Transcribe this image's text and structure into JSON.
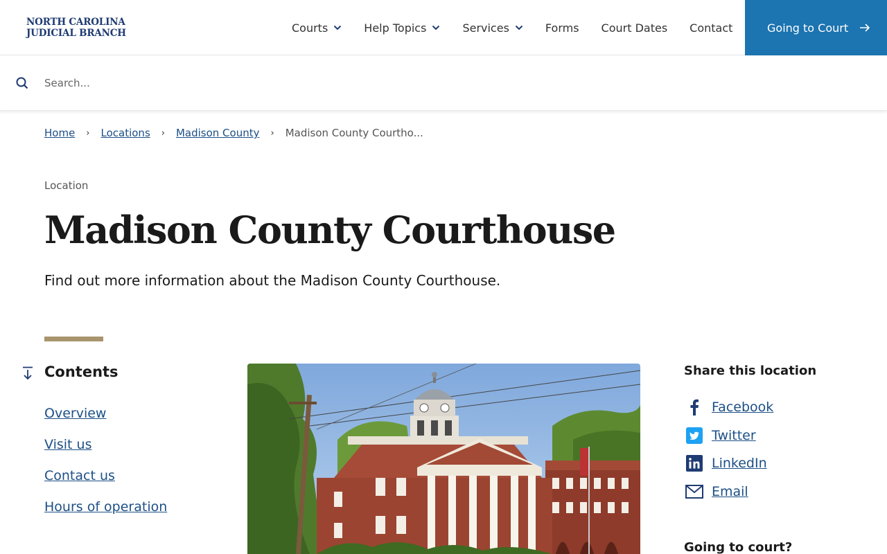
{
  "header": {
    "logo_line1": "NORTH CAROLINA",
    "logo_line2": "JUDICIAL BRANCH",
    "nav": [
      {
        "label": "Courts",
        "has_dropdown": true
      },
      {
        "label": "Help Topics",
        "has_dropdown": true
      },
      {
        "label": "Services",
        "has_dropdown": true
      },
      {
        "label": "Forms",
        "has_dropdown": false
      },
      {
        "label": "Court Dates",
        "has_dropdown": false
      },
      {
        "label": "Contact",
        "has_dropdown": false
      }
    ],
    "cta_label": "Going to Court",
    "cta_color": "#1c74b0"
  },
  "search": {
    "placeholder": "Search...",
    "value": ""
  },
  "breadcrumb": {
    "items": [
      "Home",
      "Locations",
      "Madison County"
    ],
    "current": "Madison County Courtho..."
  },
  "page": {
    "eyebrow": "Location",
    "title": "Madison County Courthouse",
    "intro": "Find out more information about the Madison County Courthouse.",
    "accent_color": "#a8946d"
  },
  "contents": {
    "title": "Contents",
    "items": [
      "Overview",
      "Visit us",
      "Contact us",
      "Hours of operation"
    ]
  },
  "share": {
    "title": "Share this location",
    "items": [
      {
        "label": "Facebook",
        "icon": "facebook-icon"
      },
      {
        "label": "Twitter",
        "icon": "twitter-icon"
      },
      {
        "label": "LinkedIn",
        "icon": "linkedin-icon"
      },
      {
        "label": "Email",
        "icon": "email-icon"
      }
    ]
  },
  "going_to_court": {
    "title": "Going to court?"
  }
}
